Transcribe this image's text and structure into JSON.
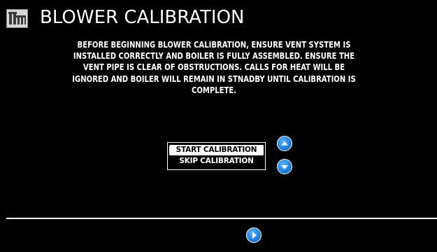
{
  "header": {
    "title": "BLOWER CALIBRATION",
    "logo_icon": "brand-logo-icon"
  },
  "message": {
    "text": "BEFORE BEGINNING BLOWER CALIBRATION, ENSURE VENT SYSTEM IS INSTALLED CORRECTLY AND BOILER IS FULLY ASSEMBLED. ENSURE THE VENT PIPE IS CLEAR OF OBSTRUCTIONS. CALLS FOR HEAT WILL BE IGNORED AND BOILER WILL REMAIN IN STNADBY UNTIL CALIBRATION IS COMPLETE."
  },
  "options": {
    "selected_index": 0,
    "items": [
      {
        "label": "START CALIBRATION"
      },
      {
        "label": "SKIP CALIBRATION"
      }
    ]
  },
  "controls": {
    "up_icon": "arrow-up-icon",
    "down_icon": "arrow-down-icon",
    "next_icon": "play-next-icon",
    "accent_color": "#1f82e0"
  }
}
